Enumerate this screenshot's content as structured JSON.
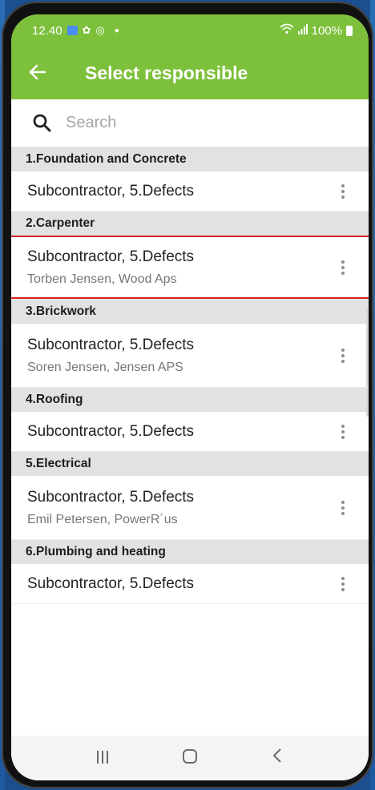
{
  "status": {
    "time": "12.40",
    "battery": "100%"
  },
  "toolbar": {
    "title": "Select responsible"
  },
  "search": {
    "placeholder": "Search"
  },
  "groups": [
    {
      "header": "1.Foundation and Concrete",
      "items": [
        {
          "title": "Subcontractor, 5.Defects",
          "subtitle": ""
        }
      ]
    },
    {
      "header": "2.Carpenter",
      "items": [
        {
          "title": "Subcontractor, 5.Defects",
          "subtitle": "Torben Jensen, Wood Aps",
          "highlighted": true
        }
      ]
    },
    {
      "header": "3.Brickwork",
      "items": [
        {
          "title": "Subcontractor, 5.Defects",
          "subtitle": "Soren Jensen, Jensen APS"
        }
      ]
    },
    {
      "header": "4.Roofing",
      "items": [
        {
          "title": "Subcontractor, 5.Defects",
          "subtitle": ""
        }
      ]
    },
    {
      "header": "5.Electrical",
      "items": [
        {
          "title": "Subcontractor, 5.Defects",
          "subtitle": "Emil Petersen, PowerR´us"
        }
      ]
    },
    {
      "header": "6.Plumbing and heating",
      "items": [
        {
          "title": "Subcontractor, 5.Defects",
          "subtitle": ""
        }
      ]
    }
  ],
  "colors": {
    "accent": "#7dc03c",
    "highlight": "#d32020",
    "group_bg": "#e2e2e2"
  },
  "icons": {
    "back": "arrow-left-icon",
    "search": "search-icon",
    "more": "more-vertical-icon"
  }
}
